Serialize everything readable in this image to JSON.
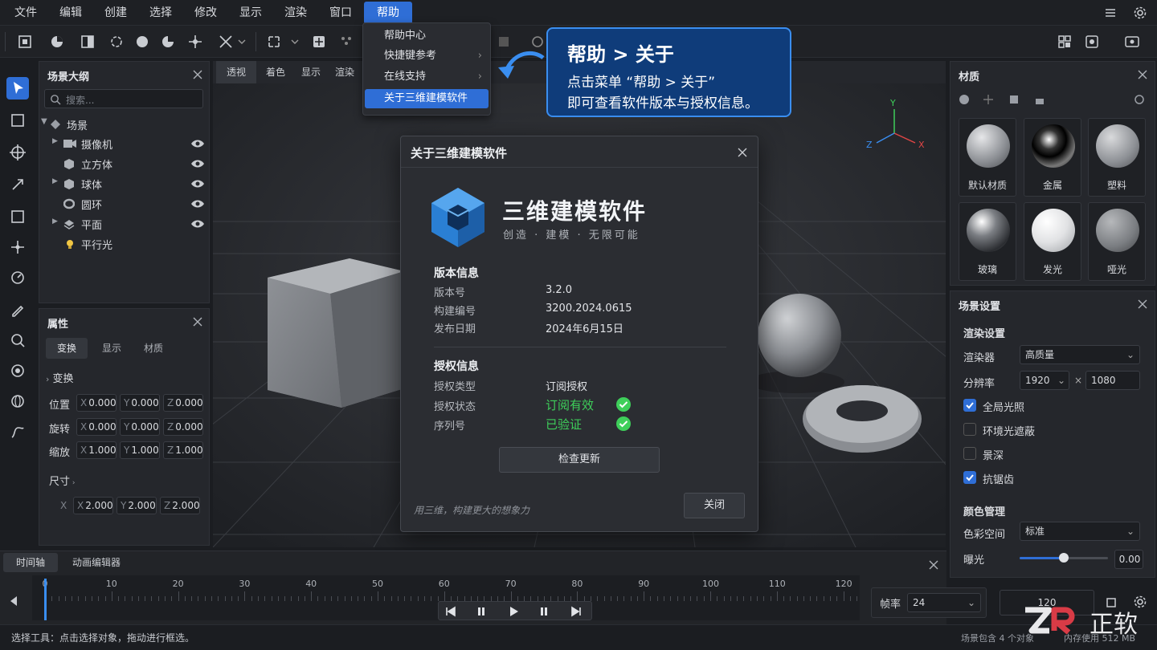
{
  "menubar": {
    "items": [
      "文件",
      "编辑",
      "创建",
      "选择",
      "修改",
      "显示",
      "渲染",
      "窗口",
      "帮助"
    ],
    "active": "帮助"
  },
  "help_menu": {
    "items": [
      "帮助中心",
      "快捷键参考",
      "在线支持",
      "关于三维建模软件"
    ],
    "active": "关于三维建模软件"
  },
  "callout": {
    "title": "帮助 > 关于",
    "line1": "点击菜单 “帮助 > 关于”",
    "line2": "即可查看软件版本与授权信息。"
  },
  "outline": {
    "title": "场景大纲",
    "search_placeholder": "搜索...",
    "root": "场景",
    "items": [
      "摄像机",
      "立方体",
      "球体",
      "圆环",
      "平面",
      "平行光"
    ]
  },
  "properties": {
    "title": "属性",
    "tabs": [
      "变换",
      "显示",
      "材质"
    ],
    "section": "变换",
    "rows": [
      {
        "label": "位置",
        "x": "0.000",
        "y": "0.000",
        "z": "0.000"
      },
      {
        "label": "旋转",
        "x": "0.000",
        "y": "0.000",
        "z": "0.000"
      },
      {
        "label": "缩放",
        "x": "1.000",
        "y": "1.000",
        "z": "1.000"
      }
    ],
    "size_label": "尺寸",
    "size": {
      "x": "2.000",
      "y": "2.000",
      "z": "2.000"
    },
    "axis_x": "X",
    "axis_y": "Y",
    "axis_z": "Z"
  },
  "viewport": {
    "tabs": [
      "透视",
      "着色",
      "显示",
      "渲染"
    ],
    "gizmo": {
      "x": "X",
      "y": "Y",
      "z": "Z"
    }
  },
  "dialog": {
    "title": "关于三维建模软件",
    "product_name": "三维建模软件",
    "tagline": "创造 · 建模 · 无限可能",
    "version_section": "版本信息",
    "version_label": "版本号",
    "version_value": "3.2.0",
    "build_label": "构建编号",
    "build_value": "3200.2024.0615",
    "release_label": "发布日期",
    "release_value": "2024年6月15日",
    "license_section": "授权信息",
    "license_type_label": "授权类型",
    "license_type_value": "订阅授权",
    "license_status_label": "授权状态",
    "license_status_value": "订阅有效",
    "serial_label": "序列号",
    "serial_value": "已验证",
    "check_update": "检查更新",
    "slogan": "用三维，构建更大的想象力",
    "close": "关闭",
    "status_color": "#3ecf5a"
  },
  "materials": {
    "title": "材质",
    "items": [
      "默认材质",
      "金属",
      "塑料",
      "玻璃",
      "发光",
      "哑光"
    ]
  },
  "scene_settings": {
    "title": "场景设置",
    "render_section": "渲染设置",
    "renderer_label": "渲染器",
    "renderer_value": "高质量",
    "resolution_label": "分辨率",
    "res_w": "1920",
    "res_x": "×",
    "res_h": "1080",
    "gi": "全局光照",
    "ao": "环境光遮蔽",
    "dof": "景深",
    "aa": "抗锯齿",
    "color_section": "颜色管理",
    "colorspace_label": "色彩空间",
    "colorspace_value": "标准",
    "exposure_label": "曝光",
    "exposure_value": "0.00",
    "exposure_level": 0.5
  },
  "timeline": {
    "tabs": [
      "时间轴",
      "动画编辑器"
    ],
    "ticks": [
      "0",
      "10",
      "20",
      "30",
      "40",
      "50",
      "60",
      "70",
      "80",
      "90",
      "100",
      "110",
      "120"
    ],
    "fps_label": "帧率",
    "fps_value": "24",
    "end_frame": "120"
  },
  "status": {
    "left": "选择工具：点击选择对象，拖动进行框选。",
    "right": "场景包含 4 个对象",
    "memory": "内存使用 512 MB"
  },
  "watermark": "ZR 正软",
  "colors": {
    "accent": "#2f6ed6",
    "callout_bg": "#0f3c7a",
    "callout_border": "#3a8ef0",
    "ok": "#3ecf5a"
  }
}
